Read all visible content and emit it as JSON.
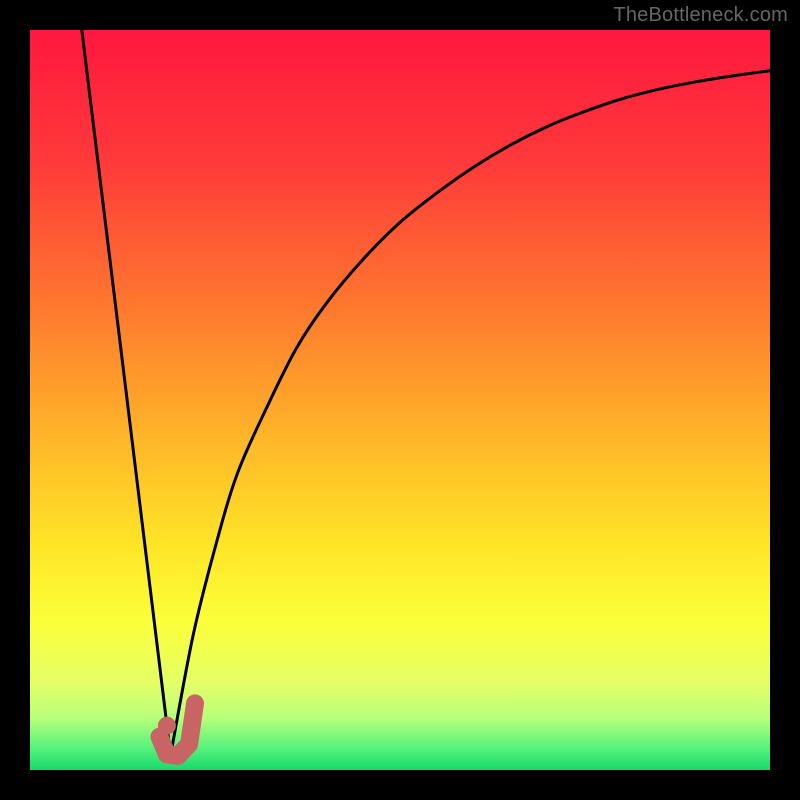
{
  "attribution": "TheBottleneck.com",
  "colors": {
    "gradient_stops": [
      {
        "offset": 0.0,
        "color": "#ff173f"
      },
      {
        "offset": 0.18,
        "color": "#ff3a3a"
      },
      {
        "offset": 0.38,
        "color": "#ff7a2e"
      },
      {
        "offset": 0.55,
        "color": "#ffb529"
      },
      {
        "offset": 0.7,
        "color": "#ffe627"
      },
      {
        "offset": 0.8,
        "color": "#fbff3a"
      },
      {
        "offset": 0.88,
        "color": "#e6ff66"
      },
      {
        "offset": 0.93,
        "color": "#b7ff7a"
      },
      {
        "offset": 0.97,
        "color": "#58f27d"
      },
      {
        "offset": 1.0,
        "color": "#17d96b"
      }
    ],
    "curve_stroke": "#000000",
    "marker_fill": "#c86464",
    "marker_stroke": "#c86464"
  },
  "chart_data": {
    "type": "line",
    "title": "",
    "xlabel": "",
    "ylabel": "",
    "xlim": [
      0,
      100
    ],
    "ylim": [
      0,
      100
    ],
    "grid": false,
    "series": [
      {
        "name": "left-branch",
        "x": [
          7,
          19
        ],
        "values": [
          100,
          2
        ]
      },
      {
        "name": "right-branch",
        "x": [
          19,
          22,
          25,
          28,
          32,
          36,
          40,
          45,
          50,
          55,
          60,
          65,
          70,
          75,
          80,
          85,
          90,
          95,
          100
        ],
        "values": [
          2,
          18,
          30,
          40,
          49,
          57,
          63,
          69,
          74,
          78,
          81.5,
          84.5,
          87,
          89,
          90.7,
          92,
          93,
          93.8,
          94.5
        ]
      }
    ],
    "marker": {
      "name": "optimal-point-marker",
      "dot": {
        "x": 18.5,
        "y": 6
      },
      "hook": [
        {
          "x": 17.5,
          "y": 4.5
        },
        {
          "x": 18.5,
          "y": 2.1
        },
        {
          "x": 20.0,
          "y": 1.9
        },
        {
          "x": 21.5,
          "y": 3.5
        },
        {
          "x": 22.3,
          "y": 9.0
        }
      ]
    }
  }
}
